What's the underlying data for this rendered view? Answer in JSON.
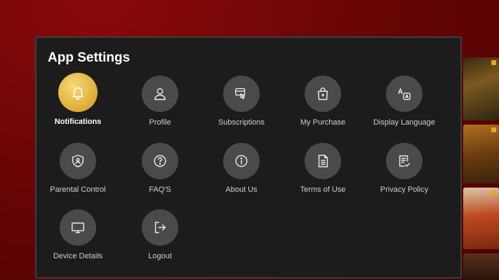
{
  "settings": {
    "title": "App Settings",
    "accent_color": "#e6b84a",
    "items": [
      {
        "label": "Notifications",
        "icon": "bell-icon",
        "active": true
      },
      {
        "label": "Profile",
        "icon": "user-icon"
      },
      {
        "label": "Subscriptions",
        "icon": "subscription-card-icon"
      },
      {
        "label": "My Purchase",
        "icon": "shopping-bag-icon"
      },
      {
        "label": "Display Language",
        "icon": "language-icon"
      },
      {
        "label": "Parental Control",
        "icon": "shield-icon"
      },
      {
        "label": "FAQ'S",
        "icon": "question-icon"
      },
      {
        "label": "About Us",
        "icon": "info-icon"
      },
      {
        "label": "Terms of Use",
        "icon": "document-icon"
      },
      {
        "label": "Privacy Policy",
        "icon": "policy-document-icon"
      },
      {
        "label": "Device Details",
        "icon": "monitor-icon"
      },
      {
        "label": "Logout",
        "icon": "logout-icon"
      }
    ]
  }
}
